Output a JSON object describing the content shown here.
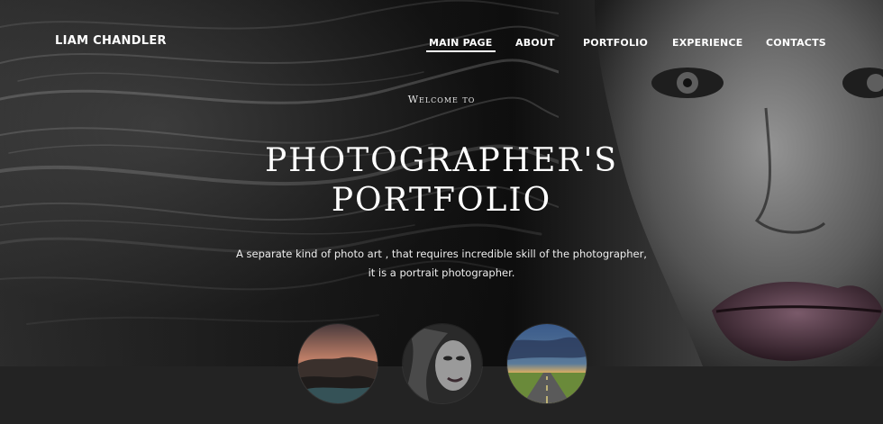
{
  "header": {
    "brand": "LIAM CHANDLER"
  },
  "nav": {
    "items": [
      {
        "label": "MAIN PAGE",
        "active": true
      },
      {
        "label": "ABOUT",
        "active": false
      },
      {
        "label": "PORTFOLIO",
        "active": false
      },
      {
        "label": "EXPERIENCE",
        "active": false
      },
      {
        "label": "CONTACTS",
        "active": false
      }
    ]
  },
  "hero": {
    "welcome": "Welcome to",
    "headline_line1": "PHOTOGRAPHER'S",
    "headline_line2": "PORTFOLIO",
    "tagline_line1": "A separate kind of photo art , that requires incredible skill of the photographer,",
    "tagline_line2": "it is a portrait photographer."
  },
  "thumbnails": [
    {
      "name": "landscape-sunset-thumbnail"
    },
    {
      "name": "portrait-thumbnail"
    },
    {
      "name": "road-storm-thumbnail"
    }
  ],
  "colors": {
    "text": "#ffffff",
    "footer_band": "#232323"
  }
}
